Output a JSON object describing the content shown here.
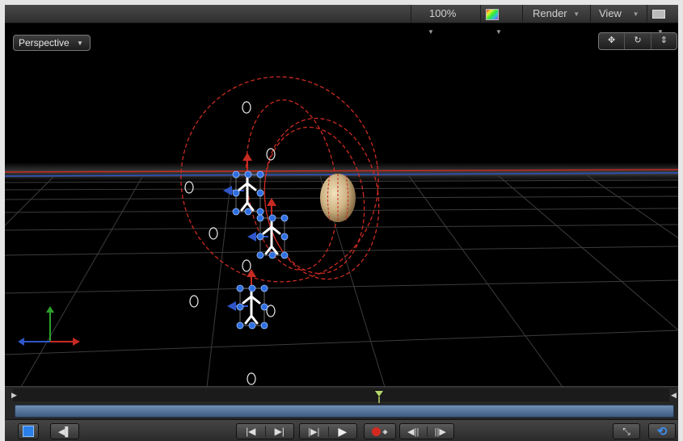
{
  "toolbar": {
    "zoom_label": "100%",
    "render_label": "Render",
    "view_label": "View"
  },
  "viewport": {
    "camera_label": "Perspective"
  },
  "icons": {
    "channel": "color-channel-icon",
    "pan": "pan-icon",
    "orbit": "orbit-icon",
    "dolly": "dolly-icon",
    "layout": "window-layout-icon",
    "playhead": "playhead-icon"
  },
  "colors": {
    "motion_path": "#cc2b22",
    "handle_blue": "#2f6fe0",
    "axis_x": "#c62a22",
    "axis_y": "#2ea02e",
    "axis_z": "#2f55c8",
    "accent": "#2a7fe8"
  }
}
